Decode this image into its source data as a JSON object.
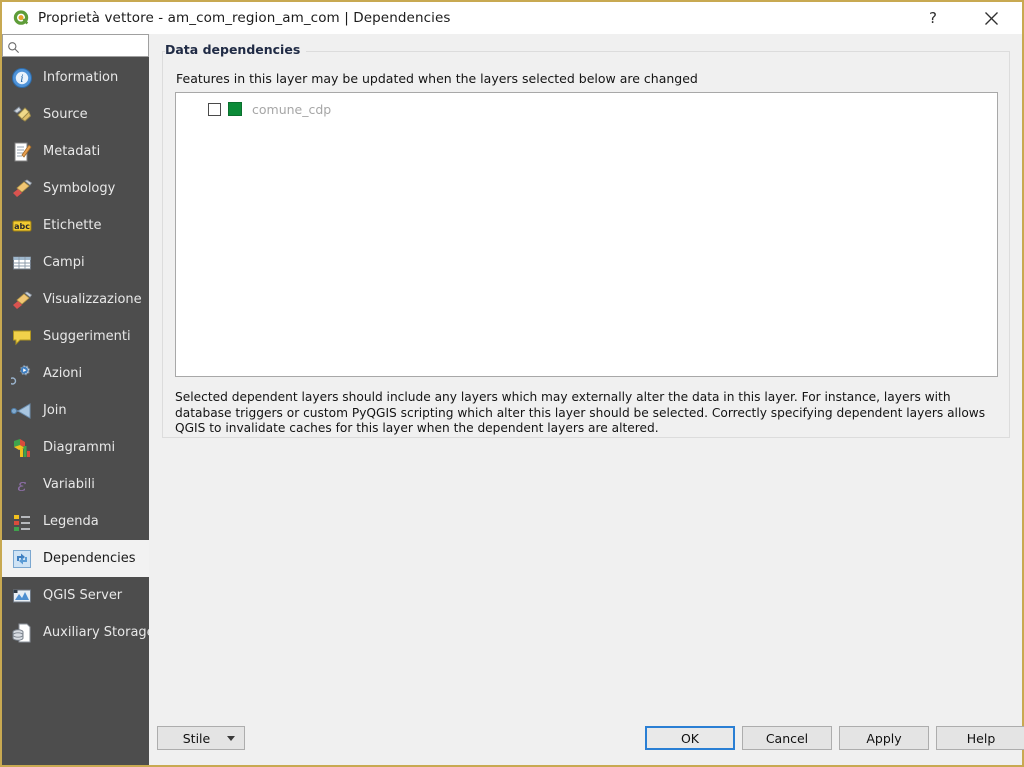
{
  "window": {
    "title": "Proprietà vettore - am_com_region_am_com | Dependencies",
    "logo_icon": "qgis-logo-icon",
    "help_button_label": "?",
    "close_button_label": "close-icon"
  },
  "sidebar": {
    "search": {
      "value": "",
      "placeholder": "",
      "icon": "search-icon"
    },
    "items": [
      {
        "label": "Information",
        "icon": "information-icon",
        "selected": false
      },
      {
        "label": "Source",
        "icon": "source-icon",
        "selected": false
      },
      {
        "label": "Metadati",
        "icon": "metadata-icon",
        "selected": false
      },
      {
        "label": "Symbology",
        "icon": "symbology-icon",
        "selected": false
      },
      {
        "label": "Etichette",
        "icon": "labels-icon",
        "selected": false
      },
      {
        "label": "Campi",
        "icon": "fields-icon",
        "selected": false
      },
      {
        "label": "Visualizzazione",
        "icon": "rendering-icon",
        "selected": false
      },
      {
        "label": "Suggerimenti",
        "icon": "display-hints-icon",
        "selected": false
      },
      {
        "label": "Azioni",
        "icon": "actions-icon",
        "selected": false
      },
      {
        "label": "Join",
        "icon": "joins-icon",
        "selected": false
      },
      {
        "label": "Diagrammi",
        "icon": "diagrams-icon",
        "selected": false
      },
      {
        "label": "Variabili",
        "icon": "variables-icon",
        "selected": false
      },
      {
        "label": "Legenda",
        "icon": "legend-icon",
        "selected": false
      },
      {
        "label": "Dependencies",
        "icon": "dependencies-icon",
        "selected": true
      },
      {
        "label": "QGIS Server",
        "icon": "qgis-server-icon",
        "selected": false
      },
      {
        "label": "Auxiliary Storage",
        "icon": "auxiliary-storage-icon",
        "selected": false
      }
    ]
  },
  "main": {
    "group_title": "Data dependencies",
    "description_top": "Features in this layer may be updated when the layers selected below are changed",
    "layers": [
      {
        "name": "comune_cdp",
        "checked": false,
        "swatch_color": "#0b8b38"
      }
    ],
    "description_bottom": "Selected dependent layers should include any layers which may externally alter the data in this layer. For instance, layers with database triggers or custom PyQGIS scripting which alter this layer should be selected. Correctly specifying dependent layers allows QGIS to invalidate caches for this layer when the dependent layers are altered."
  },
  "footer": {
    "style_button": "Stile",
    "ok_button": "OK",
    "cancel_button": "Cancel",
    "apply_button": "Apply",
    "help_button": "Help"
  },
  "colors": {
    "window_border": "#c8a951",
    "sidebar_bg": "#4d4d4d",
    "panel_bg": "#f0f0f0",
    "group_title": "#202b45",
    "focus_border": "#2a7fd4",
    "layer_swatch": "#0b8b38",
    "layer_name_text": "#a6a6a6"
  }
}
